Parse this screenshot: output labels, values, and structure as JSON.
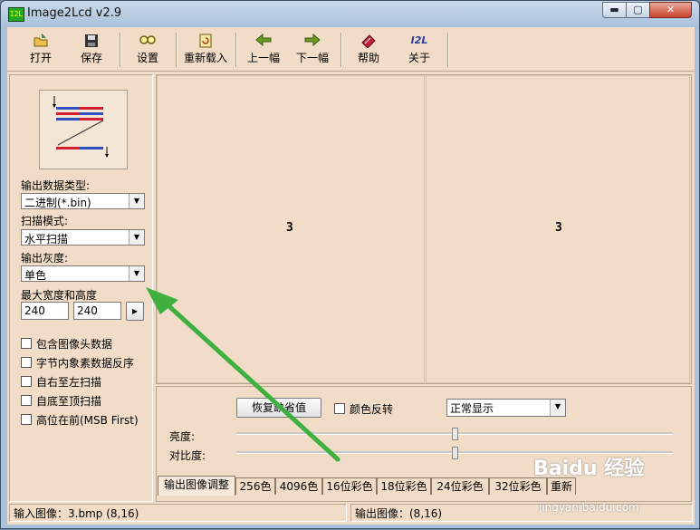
{
  "window": {
    "title": "Image2Lcd v2.9",
    "icon_text": "I2L",
    "min_glyph": "▬",
    "max_glyph": "▢",
    "close_glyph": "✕"
  },
  "toolbar": {
    "open": "打开",
    "save": "保存",
    "settings": "设置",
    "reload": "重新载入",
    "prev": "上一幅",
    "next": "下一幅",
    "help": "帮助",
    "about": "关于",
    "about_icon_text": "I2L"
  },
  "left": {
    "output_type_label": "输出数据类型:",
    "output_type_value": "二进制(*.bin)",
    "scan_mode_label": "扫描模式:",
    "scan_mode_value": "水平扫描",
    "gray_label": "输出灰度:",
    "gray_value": "单色",
    "size_label": "最大宽度和高度",
    "width_value": "240",
    "height_value": "240",
    "size_btn": "▸",
    "options": [
      "包含图像头数据",
      "字节内象素数据反序",
      "自右至左扫描",
      "自底至顶扫描",
      "高位在前(MSB First)"
    ]
  },
  "preview": {
    "input_glyph": "3",
    "output_glyph": "3"
  },
  "adjust": {
    "restore_btn": "恢复缺省值",
    "invert_label": "颜色反转",
    "display_mode": "正常显示",
    "brightness_label": "亮度:",
    "contrast_label": "对比度:",
    "brightness_value": 0.5,
    "contrast_value": 0.5
  },
  "tabs": [
    "输出图像调整",
    "256色",
    "4096色",
    "16位彩色",
    "18位彩色",
    "24位彩色",
    "32位彩色",
    "重新"
  ],
  "status": {
    "input": "输入图像：3.bmp (8,16)",
    "output": "输出图像：(8,16)"
  },
  "watermark": {
    "brand": "Baidu 经验",
    "url": "jingyan.baidu.com"
  },
  "colors": {
    "annotation_arrow": "#3fb040",
    "panel_bg": "#f0dcc7"
  }
}
